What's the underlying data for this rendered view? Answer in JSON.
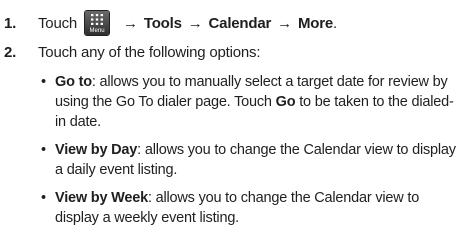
{
  "step1": {
    "number": "1.",
    "prefix": "Touch",
    "key_label": "Menu",
    "arrow": "→",
    "path": [
      "Tools",
      "Calendar",
      "More"
    ],
    "end": "."
  },
  "step2": {
    "number": "2.",
    "text": "Touch any of the following options:"
  },
  "options": [
    {
      "title": "Go to",
      "segments": [
        ": allows you to manually select a target date for review by using the Go To dialer page. Touch ",
        "Go",
        " to be taken to the dialed-in date."
      ]
    },
    {
      "title": "View by Day",
      "text": ": allows you to change the Calendar view to display a daily event listing."
    },
    {
      "title": "View by Week",
      "text": ": allows you to change the Calendar view to display a weekly event listing."
    }
  ],
  "bullet_char": "•",
  "icons": {
    "menu_key": "menu-grid-icon"
  }
}
